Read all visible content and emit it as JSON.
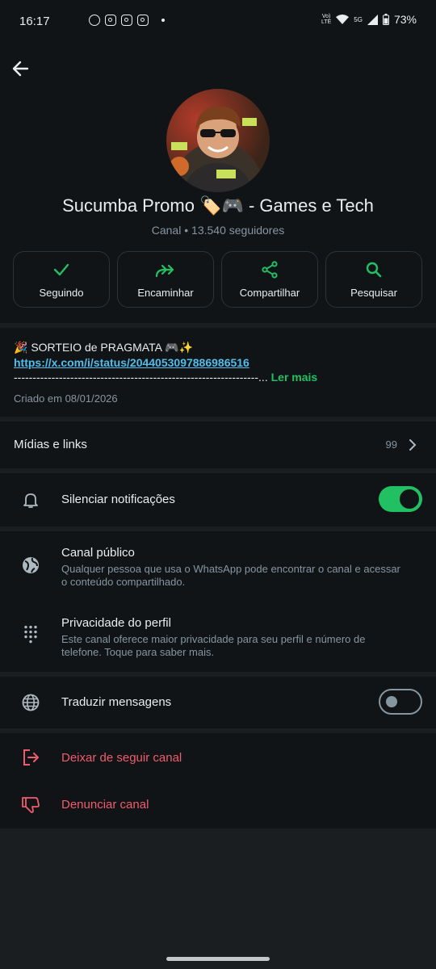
{
  "status_bar": {
    "time": "16:17",
    "network_top": "Vo)",
    "network_bottom": "LTE",
    "signal_label": "5G",
    "battery": "73%"
  },
  "header": {
    "channel_name": "Sucumba Promo 🏷️🎮  - Games e Tech",
    "channel_type": "Canal",
    "followers": "13.540 seguidores",
    "separator": " • "
  },
  "actions": [
    {
      "label": "Seguindo",
      "icon": "check-icon"
    },
    {
      "label": "Encaminhar",
      "icon": "forward-icon"
    },
    {
      "label": "Compartilhar",
      "icon": "share-icon"
    },
    {
      "label": "Pesquisar",
      "icon": "search-icon"
    }
  ],
  "description": {
    "title": "🎉 SORTEIO de PRAGMATA 🎮✨",
    "link": "https://x.com/i/status/2044053097886986516",
    "dashes": "-----------------------------------------------------------------...",
    "more": " Ler mais",
    "created": "Criado em 08/01/2026"
  },
  "media": {
    "label": "Mídias e links",
    "count": "99"
  },
  "mute": {
    "label": "Silenciar notificações",
    "enabled": true
  },
  "public_channel": {
    "title": "Canal público",
    "subtitle": "Qualquer pessoa que usa o WhatsApp pode encontrar o canal e acessar o conteúdo compartilhado."
  },
  "profile_privacy": {
    "title": "Privacidade do perfil",
    "subtitle": "Este canal oferece maior privacidade para seu perfil e número de telefone. Toque para saber mais."
  },
  "translate": {
    "label": "Traduzir mensagens",
    "enabled": false
  },
  "unfollow": {
    "label": "Deixar de seguir canal"
  },
  "report": {
    "label": "Denunciar canal"
  },
  "colors": {
    "accent": "#21c063",
    "link": "#53bdeb",
    "danger": "#f15c6d",
    "background": "#111416",
    "divider": "#1a1e21"
  }
}
